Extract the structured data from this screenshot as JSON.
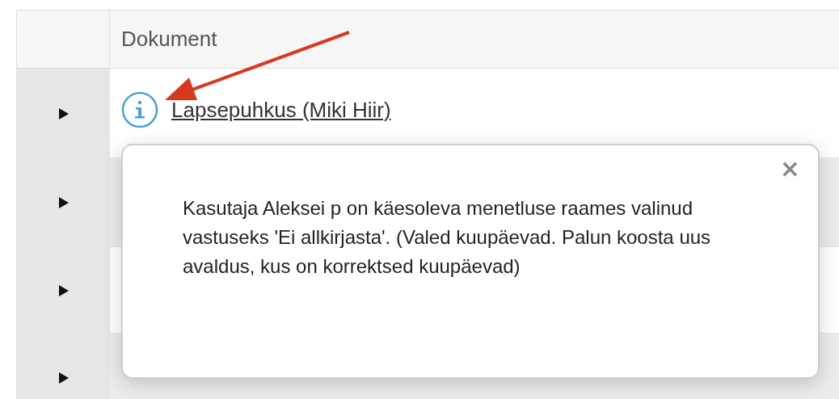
{
  "table": {
    "columns": [
      "Dokument"
    ],
    "rows": [
      {
        "expanded": false,
        "info": true,
        "document": "Lapsepuhkus (Miki Hiir)"
      },
      {
        "expanded": false,
        "info": false
      },
      {
        "expanded": false,
        "info": false
      },
      {
        "expanded": false,
        "info": false
      }
    ]
  },
  "popover": {
    "close": "×",
    "message": "Kasutaja Aleksei p on käesoleva menetluse raames valinud vastuseks 'Ei allkirjasta'. (Valed kuupäevad. Palun koosta uus avaldus, kus on korrektsed kuupäevad)"
  }
}
